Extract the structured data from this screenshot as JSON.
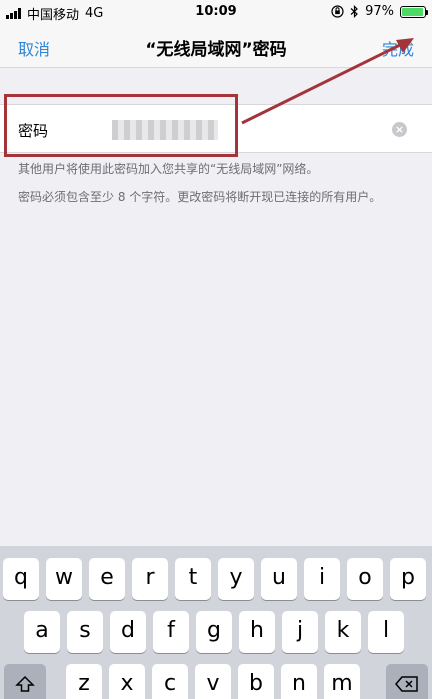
{
  "status_bar": {
    "carrier": "中国移动",
    "network": "4G",
    "time": "10:09",
    "battery_percent": "97%",
    "battery_level": 0.97,
    "icons": [
      "signal-icon",
      "lock-rotation-icon",
      "bluetooth-icon",
      "battery-icon"
    ]
  },
  "navbar": {
    "cancel_label": "取消",
    "title": "“无线局域网”密码",
    "done_label": "完成"
  },
  "password_field": {
    "label": "密码",
    "value_obscured": true
  },
  "notes": {
    "line1": "其他用户将使用此密码加入您共享的“无线局域网”网络。",
    "line2": "密码必须包含至少 8 个字符。更改密码将断开现已连接的所有用户。"
  },
  "annotation": {
    "box_color": "#a2343a",
    "arrow_color": "#a2343a"
  },
  "keyboard": {
    "row1": [
      "q",
      "w",
      "e",
      "r",
      "t",
      "y",
      "u",
      "i",
      "o",
      "p"
    ],
    "row2": [
      "a",
      "s",
      "d",
      "f",
      "g",
      "h",
      "j",
      "k",
      "l"
    ],
    "row3": [
      "z",
      "x",
      "c",
      "v",
      "b",
      "n",
      "m"
    ],
    "shift_icon": "shift-icon",
    "delete_icon": "delete-icon"
  },
  "colors": {
    "accent": "#2f86d6",
    "background": "#efeff4"
  }
}
